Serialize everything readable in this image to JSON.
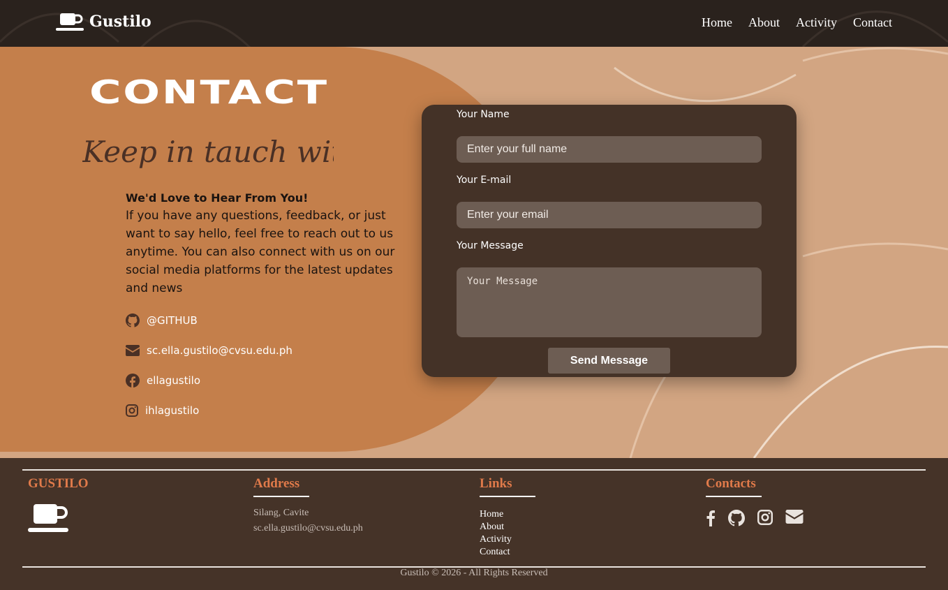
{
  "nav": {
    "brand": "Gustilo",
    "links": [
      "Home",
      "About",
      "Activity",
      "Contact"
    ]
  },
  "hero": {
    "title": "CONTACT",
    "script": "Keep in tauch with me !",
    "heading": "We'd Love to Hear From You!",
    "body": "If you have any questions, feedback, or just want to say hello, feel free to reach out to us anytime. You can also connect with us on our social media platforms for the latest updates and news",
    "social": [
      {
        "icon": "github-icon",
        "text": "@GITHUB"
      },
      {
        "icon": "envelope-icon",
        "text": "sc.ella.gustilo@cvsu.edu.ph"
      },
      {
        "icon": "facebook-icon",
        "text": "ellagustilo"
      },
      {
        "icon": "instagram-icon",
        "text": "ihlagustilo"
      }
    ]
  },
  "form": {
    "name_label": "Your Name",
    "name_placeholder": "Enter your full name",
    "email_label": "Your E-mail",
    "email_placeholder": "Enter your email",
    "message_label": "Your Message",
    "message_placeholder": "Your Message",
    "submit": "Send Message"
  },
  "footer": {
    "brand": "GUSTILO",
    "address_heading": "Address",
    "address_line": "Silang, Cavite",
    "address_email": "sc.ella.gustilo@cvsu.edu.ph",
    "links_heading": "Links",
    "links": [
      "Home",
      "About",
      "Activity",
      "Contact"
    ],
    "contacts_heading": "Contacts",
    "contact_icons": [
      "facebook-icon",
      "github-icon",
      "instagram-icon",
      "envelope-icon"
    ],
    "copyright": "Gustilo © 2026 - All Rights Reserved"
  },
  "colors": {
    "navbar": "#2a221d",
    "hero_bg": "#d2a582",
    "blob": "#c47f4b",
    "card": "#443227",
    "input": "#6d5d53",
    "footer": "#453328",
    "footer_heading": "#e07a4a"
  }
}
